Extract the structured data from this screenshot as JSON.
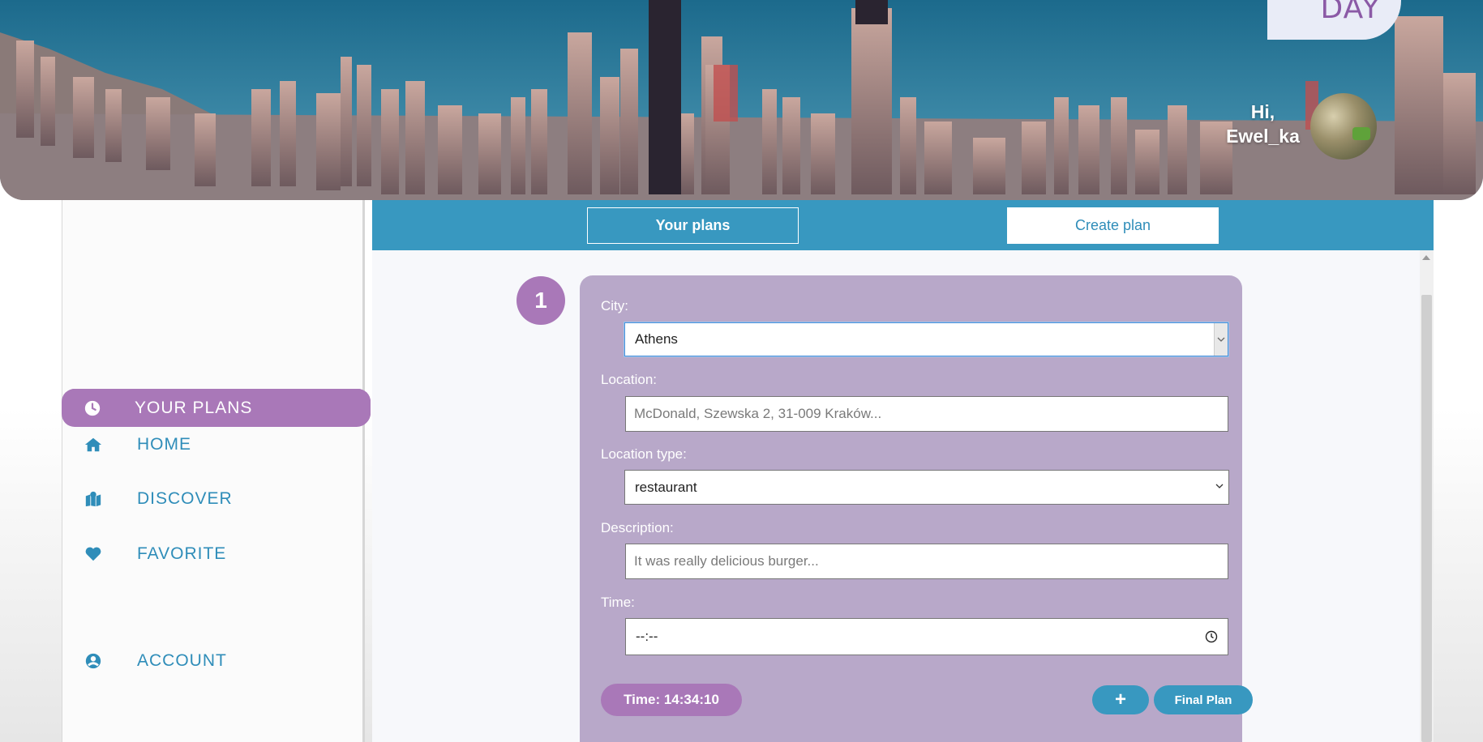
{
  "header": {
    "logo_text": "DAY",
    "greeting_line1": "Hi,",
    "greeting_line2": "Ewel_ka"
  },
  "sidebar": {
    "items": [
      {
        "label": "HOME",
        "icon": "home-icon"
      },
      {
        "label": "DISCOVER",
        "icon": "map-marker-icon"
      },
      {
        "label": "FAVORITE",
        "icon": "heart-icon"
      },
      {
        "label": "YOUR PLANS",
        "icon": "clock-icon",
        "active": true
      },
      {
        "label": "ACCOUNT",
        "icon": "user-circle-icon"
      }
    ]
  },
  "tabs": {
    "your_plans": "Your plans",
    "create_plan": "Create plan"
  },
  "plan": {
    "step_number": "1",
    "city_label": "City:",
    "city_value": "Athens",
    "location_label": "Location:",
    "location_placeholder": "McDonald, Szewska 2, 31-009 Kraków...",
    "location_type_label": "Location type:",
    "location_type_value": "restaurant",
    "description_label": "Description:",
    "description_placeholder": "It was really delicious burger...",
    "time_label": "Time:",
    "time_value": "--:--",
    "time_pill": "Time: 14:34:10",
    "add_button": "+",
    "final_button": "Final Plan"
  },
  "colors": {
    "accent_blue": "#3898c0",
    "accent_purple": "#a978b8",
    "card_bg": "#b8a8c9"
  }
}
